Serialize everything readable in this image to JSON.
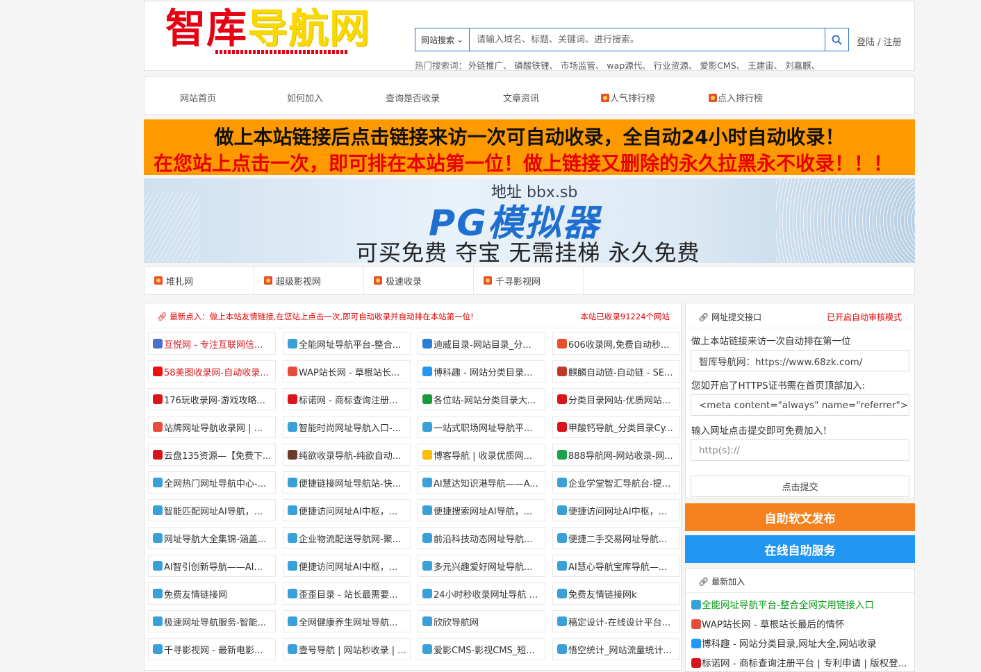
{
  "header": {
    "logo_red": "智库",
    "logo_yellow": "导航网",
    "search_select": "网站搜索",
    "search_placeholder": "请输入域名、标题、关键词、进行搜索。",
    "login": "登陆 / 注册",
    "hot_label": "热门搜索词：",
    "hot_words": "外链推广、  磷酸铁锂、  市场监管、  wap源代、  行业资源、  爱影CMS、  王建宙、  刘嘉麒、"
  },
  "nav": [
    "网站首页",
    "如何加入",
    "查询是否收录",
    "文章资讯",
    "人气排行榜",
    "点入排行榜"
  ],
  "banner1": {
    "line1": "做上本站链接后点击链接来访一次可自动收录，全自动24小时自动收录！",
    "line2": "在您站上点击一次，即可排在本站第一位！做上链接又删除的永久拉黑永不收录！！！"
  },
  "banner2": {
    "addr": "地址   bbx.sb",
    "title": "PG模拟器",
    "sub": "可买免费 夺宝   无需挂梯   永久免费"
  },
  "friend_links": [
    "堆扎网",
    "超级影视网",
    "极速收录",
    "千寻影视网"
  ],
  "latest_in": {
    "title": "最新点入：做上本站友情链接,在您站上点击一次,即可自动收录并自动排在本站第一位!",
    "count": "本站已收录91224个网站"
  },
  "sites": [
    [
      "互悦网 - 专注互联网信...",
      "全能网址导航平台-整合...",
      "迪威目录-网站目录_分...",
      "606收录网,免费自动秒..."
    ],
    [
      "58美图收录网-自动收录...",
      "WAP站长网 - 草根站长...",
      "博科趣 - 网站分类目录...",
      "麒麟自动链-自动链 - SE..."
    ],
    [
      "176玩收录网-游戏攻略...",
      "标诺网 - 商标查询注册...",
      "各位站-网站分类目录大...",
      "分类目录网站-优质网站..."
    ],
    [
      "站牌网址导航收录网 | ...",
      "智能时尚网址导航入口-...",
      "一站式职场网址导航平...",
      "甲酸钙导航_分类目录Cy..."
    ],
    [
      "云盘135资源—【免费下...",
      "纯欲收录导航-纯欲自动...",
      "博客导航 | 收录优质网...",
      "888导航网-网站收录-网..."
    ],
    [
      "全网热门网址导航中心-...",
      "便捷链接网址导航站-快...",
      "AI慧达知识港导航——A...",
      "企业学堂智汇导航台-提..."
    ],
    [
      "智能匹配网址AI导航，...",
      "便捷访问网址AI中枢，...",
      "便捷搜索网址AI导航，...",
      "便捷访问网址AI中枢，..."
    ],
    [
      "网址导航大全集锦-涵盖...",
      "企业物流配送导航网-聚...",
      "前沿科技动态网址导航...",
      "便捷二手交易网址导航..."
    ],
    [
      "AI智引创新导航——AI...",
      "便捷访问网址AI中枢，...",
      "多元兴趣爱好网址导航...",
      "AI慧心导航宝库导航—..."
    ],
    [
      "免费友情链接网",
      "歪歪目录 - 站长最需要...",
      "24小时秒收录网址导航 ...",
      "免费友情链接网k"
    ],
    [
      "极速网址导航服务-智能...",
      "全网健康养生网址导航...",
      "欣欣导航网",
      "稿定设计-在线设计平台..."
    ],
    [
      "千寻影视网 - 最新电影...",
      "壹号导航 | 网站秒收录 | ...",
      "爱影CMS-影视CMS_短...",
      "悟空统计_网站流量统计..."
    ]
  ],
  "site_colors": [
    [
      "#d9151b",
      "#333",
      "#333",
      "#333"
    ],
    [
      "#d9151b",
      "#333",
      "#333",
      "#333"
    ],
    [
      "#333",
      "#333",
      "#333",
      "#333"
    ],
    [
      "#333",
      "#333",
      "#333",
      "#333"
    ],
    [
      "#333",
      "#333",
      "#333",
      "#333"
    ],
    [
      "#333",
      "#333",
      "#333",
      "#333"
    ],
    [
      "#333",
      "#333",
      "#333",
      "#333"
    ],
    [
      "#333",
      "#333",
      "#333",
      "#333"
    ],
    [
      "#333",
      "#333",
      "#333",
      "#333"
    ],
    [
      "#333",
      "#333",
      "#333",
      "#333"
    ],
    [
      "#333",
      "#333",
      "#333",
      "#333"
    ],
    [
      "#333",
      "#333",
      "#333",
      "#333"
    ]
  ],
  "submit": {
    "title": "网址提交接口",
    "mode": "已开启自动审核模式",
    "p1": "做上本站链接来访一次自动排在第一位",
    "box1": "智库导航网：https://www.68zk.com/",
    "p2": "您如开启了HTTPS证书需在首页顶部加入:",
    "box2": "<meta content=\"always\" name=\"referrer\">",
    "p3": "输入网址点击提交即可免费加入！",
    "url_placeholder": "http(s)://",
    "button": "点击提交"
  },
  "btn_orange": "自助软文发布",
  "btn_blue": "在线自助服务",
  "latest_join": {
    "title": "最新加入",
    "items": [
      "全能网址导航平台-整合全网实用链接入口",
      "WAP站长网 - 草根站长最后的情怀",
      "博科趣 - 网站分类目录,网址大全,网站收录",
      "标诺网 - 商标查询注册平台 | 专利申请 | 版权登..."
    ],
    "colors": [
      "#0a9a1a",
      "#333",
      "#333",
      "#333"
    ]
  }
}
